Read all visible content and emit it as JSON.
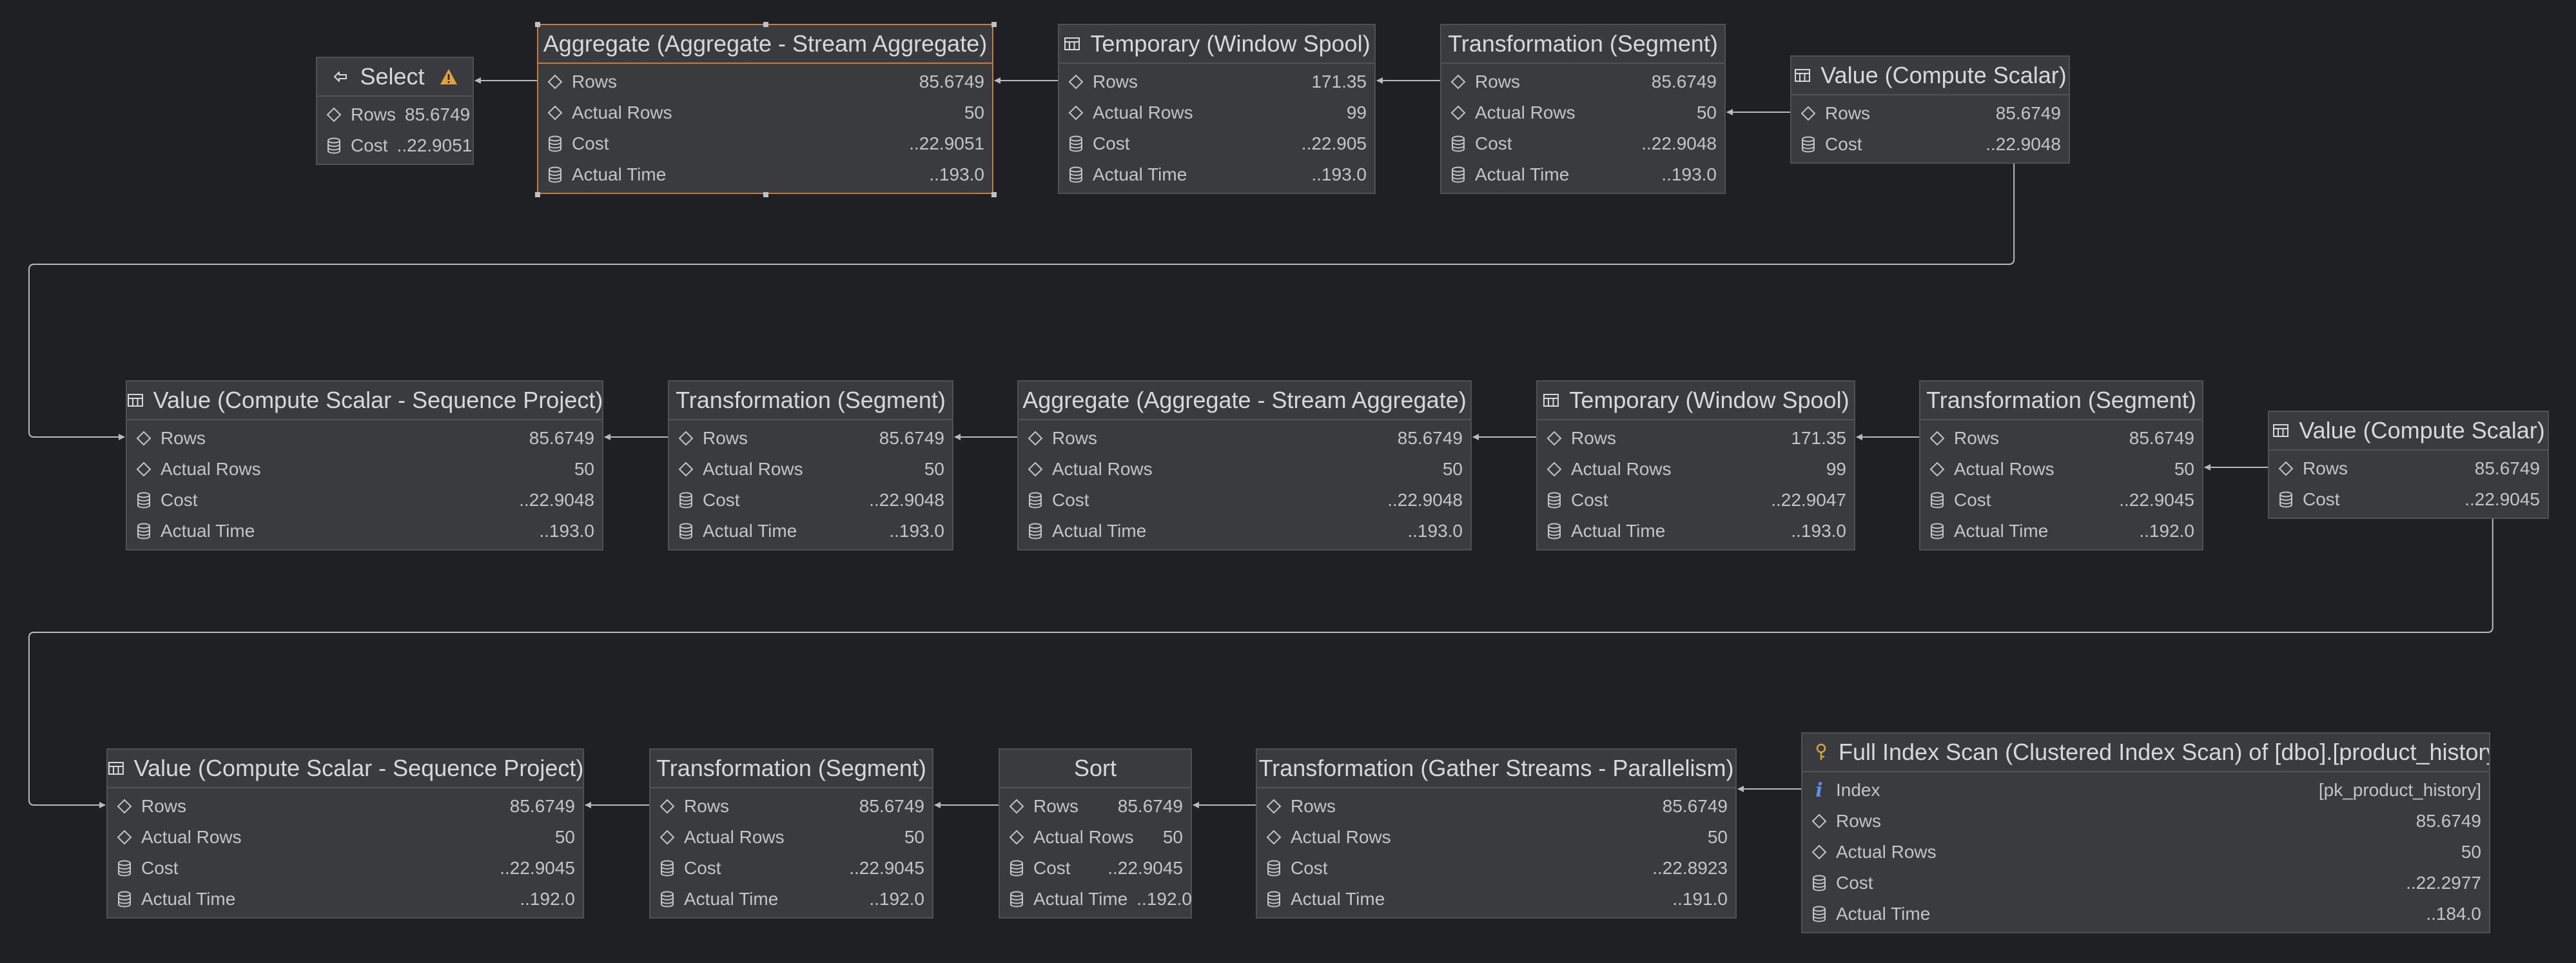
{
  "nodes": [
    {
      "id": "select",
      "title": "Select",
      "icon": "arrow-left-exit-icon",
      "warning": true,
      "rows": [
        {
          "icon": "diamond-icon",
          "label": "Rows",
          "value": "85.6749"
        },
        {
          "icon": "database-icon",
          "label": "Cost",
          "value": "..22.9051"
        }
      ]
    },
    {
      "id": "aggregate-1",
      "title": "Aggregate (Aggregate - Stream Aggregate)",
      "icon": "",
      "selected": true,
      "rows": [
        {
          "icon": "diamond-icon",
          "label": "Rows",
          "value": "85.6749"
        },
        {
          "icon": "diamond-icon",
          "label": "Actual Rows",
          "value": "50"
        },
        {
          "icon": "database-icon",
          "label": "Cost",
          "value": "..22.9051"
        },
        {
          "icon": "database-icon",
          "label": "Actual Time",
          "value": "..193.0"
        }
      ]
    },
    {
      "id": "temporary-1",
      "title": "Temporary (Window Spool)",
      "icon": "table-icon",
      "rows": [
        {
          "icon": "diamond-icon",
          "label": "Rows",
          "value": "171.35"
        },
        {
          "icon": "diamond-icon",
          "label": "Actual Rows",
          "value": "99"
        },
        {
          "icon": "database-icon",
          "label": "Cost",
          "value": "..22.905"
        },
        {
          "icon": "database-icon",
          "label": "Actual Time",
          "value": "..193.0"
        }
      ]
    },
    {
      "id": "transformation-1",
      "title": "Transformation (Segment)",
      "icon": "",
      "rows": [
        {
          "icon": "diamond-icon",
          "label": "Rows",
          "value": "85.6749"
        },
        {
          "icon": "diamond-icon",
          "label": "Actual Rows",
          "value": "50"
        },
        {
          "icon": "database-icon",
          "label": "Cost",
          "value": "..22.9048"
        },
        {
          "icon": "database-icon",
          "label": "Actual Time",
          "value": "..193.0"
        }
      ]
    },
    {
      "id": "value-1",
      "title": "Value (Compute Scalar)",
      "icon": "table-icon",
      "rows": [
        {
          "icon": "diamond-icon",
          "label": "Rows",
          "value": "85.6749"
        },
        {
          "icon": "database-icon",
          "label": "Cost",
          "value": "..22.9048"
        }
      ]
    },
    {
      "id": "value-seq-1",
      "title": "Value (Compute Scalar - Sequence Project)",
      "icon": "table-icon",
      "rows": [
        {
          "icon": "diamond-icon",
          "label": "Rows",
          "value": "85.6749"
        },
        {
          "icon": "diamond-icon",
          "label": "Actual Rows",
          "value": "50"
        },
        {
          "icon": "database-icon",
          "label": "Cost",
          "value": "..22.9048"
        },
        {
          "icon": "database-icon",
          "label": "Actual Time",
          "value": "..193.0"
        }
      ]
    },
    {
      "id": "transformation-2",
      "title": "Transformation (Segment)",
      "icon": "",
      "rows": [
        {
          "icon": "diamond-icon",
          "label": "Rows",
          "value": "85.6749"
        },
        {
          "icon": "diamond-icon",
          "label": "Actual Rows",
          "value": "50"
        },
        {
          "icon": "database-icon",
          "label": "Cost",
          "value": "..22.9048"
        },
        {
          "icon": "database-icon",
          "label": "Actual Time",
          "value": "..193.0"
        }
      ]
    },
    {
      "id": "aggregate-2",
      "title": "Aggregate (Aggregate - Stream Aggregate)",
      "icon": "",
      "rows": [
        {
          "icon": "diamond-icon",
          "label": "Rows",
          "value": "85.6749"
        },
        {
          "icon": "diamond-icon",
          "label": "Actual Rows",
          "value": "50"
        },
        {
          "icon": "database-icon",
          "label": "Cost",
          "value": "..22.9048"
        },
        {
          "icon": "database-icon",
          "label": "Actual Time",
          "value": "..193.0"
        }
      ]
    },
    {
      "id": "temporary-2",
      "title": "Temporary (Window Spool)",
      "icon": "table-icon",
      "rows": [
        {
          "icon": "diamond-icon",
          "label": "Rows",
          "value": "171.35"
        },
        {
          "icon": "diamond-icon",
          "label": "Actual Rows",
          "value": "99"
        },
        {
          "icon": "database-icon",
          "label": "Cost",
          "value": "..22.9047"
        },
        {
          "icon": "database-icon",
          "label": "Actual Time",
          "value": "..193.0"
        }
      ]
    },
    {
      "id": "transformation-3",
      "title": "Transformation (Segment)",
      "icon": "",
      "rows": [
        {
          "icon": "diamond-icon",
          "label": "Rows",
          "value": "85.6749"
        },
        {
          "icon": "diamond-icon",
          "label": "Actual Rows",
          "value": "50"
        },
        {
          "icon": "database-icon",
          "label": "Cost",
          "value": "..22.9045"
        },
        {
          "icon": "database-icon",
          "label": "Actual Time",
          "value": "..192.0"
        }
      ]
    },
    {
      "id": "value-2",
      "title": "Value (Compute Scalar)",
      "icon": "table-icon",
      "rows": [
        {
          "icon": "diamond-icon",
          "label": "Rows",
          "value": "85.6749"
        },
        {
          "icon": "database-icon",
          "label": "Cost",
          "value": "..22.9045"
        }
      ]
    },
    {
      "id": "value-seq-2",
      "title": "Value (Compute Scalar - Sequence Project)",
      "icon": "table-icon",
      "rows": [
        {
          "icon": "diamond-icon",
          "label": "Rows",
          "value": "85.6749"
        },
        {
          "icon": "diamond-icon",
          "label": "Actual Rows",
          "value": "50"
        },
        {
          "icon": "database-icon",
          "label": "Cost",
          "value": "..22.9045"
        },
        {
          "icon": "database-icon",
          "label": "Actual Time",
          "value": "..192.0"
        }
      ]
    },
    {
      "id": "transformation-4",
      "title": "Transformation (Segment)",
      "icon": "",
      "rows": [
        {
          "icon": "diamond-icon",
          "label": "Rows",
          "value": "85.6749"
        },
        {
          "icon": "diamond-icon",
          "label": "Actual Rows",
          "value": "50"
        },
        {
          "icon": "database-icon",
          "label": "Cost",
          "value": "..22.9045"
        },
        {
          "icon": "database-icon",
          "label": "Actual Time",
          "value": "..192.0"
        }
      ]
    },
    {
      "id": "sort",
      "title": "Sort",
      "icon": "",
      "rows": [
        {
          "icon": "diamond-icon",
          "label": "Rows",
          "value": "85.6749"
        },
        {
          "icon": "diamond-icon",
          "label": "Actual Rows",
          "value": "50"
        },
        {
          "icon": "database-icon",
          "label": "Cost",
          "value": "..22.9045"
        },
        {
          "icon": "database-icon",
          "label": "Actual Time",
          "value": "..192.0"
        }
      ]
    },
    {
      "id": "transformation-5",
      "title": "Transformation (Gather Streams - Parallelism)",
      "icon": "",
      "rows": [
        {
          "icon": "diamond-icon",
          "label": "Rows",
          "value": "85.6749"
        },
        {
          "icon": "diamond-icon",
          "label": "Actual Rows",
          "value": "50"
        },
        {
          "icon": "database-icon",
          "label": "Cost",
          "value": "..22.8923"
        },
        {
          "icon": "database-icon",
          "label": "Actual Time",
          "value": "..191.0"
        }
      ]
    },
    {
      "id": "full-index-scan",
      "title": "Full Index Scan (Clustered Index Scan) of [dbo].[product_history]",
      "icon": "key-icon",
      "rows": [
        {
          "icon": "info-icon",
          "label": "Index",
          "value": "[pk_product_history]"
        },
        {
          "icon": "diamond-icon",
          "label": "Rows",
          "value": "85.6749"
        },
        {
          "icon": "diamond-icon",
          "label": "Actual Rows",
          "value": "50"
        },
        {
          "icon": "database-icon",
          "label": "Cost",
          "value": "..22.2977"
        },
        {
          "icon": "database-icon",
          "label": "Actual Time",
          "value": "..184.0"
        }
      ]
    }
  ],
  "edges": [
    [
      "aggregate-1",
      "select"
    ],
    [
      "temporary-1",
      "aggregate-1"
    ],
    [
      "transformation-1",
      "temporary-1"
    ],
    [
      "value-1",
      "transformation-1"
    ],
    [
      "value-seq-1",
      "value-1"
    ],
    [
      "transformation-2",
      "value-seq-1"
    ],
    [
      "aggregate-2",
      "transformation-2"
    ],
    [
      "temporary-2",
      "aggregate-2"
    ],
    [
      "transformation-3",
      "temporary-2"
    ],
    [
      "value-2",
      "transformation-3"
    ],
    [
      "value-seq-2",
      "value-2"
    ],
    [
      "transformation-4",
      "value-seq-2"
    ],
    [
      "sort",
      "transformation-4"
    ],
    [
      "transformation-5",
      "sort"
    ],
    [
      "full-index-scan",
      "transformation-5"
    ]
  ],
  "colors": {
    "background": "#1f2023",
    "node_fill": "#393b3e",
    "node_border": "#4e5054",
    "selected_border": "#c77c3c",
    "warning": "#e2a03f",
    "key_icon": "#d9a441",
    "info_icon": "#5f8fe6",
    "edge": "#b8babd"
  }
}
